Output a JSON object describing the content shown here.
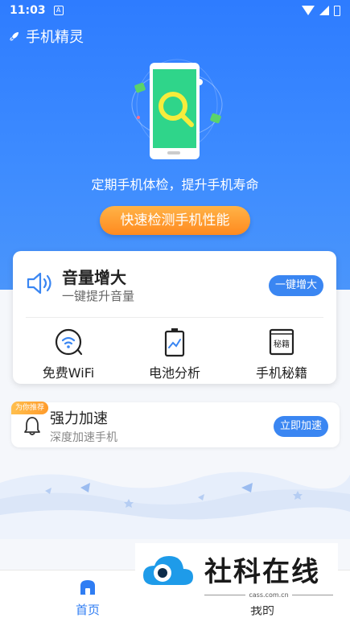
{
  "status_bar": {
    "time": "11:03",
    "notification_glyph": "A"
  },
  "app": {
    "title": "手机精灵",
    "icon": "rocket-icon"
  },
  "hero": {
    "slogan": "定期手机体检，提升手机寿命",
    "check_button": "快速检测手机性能"
  },
  "volume_card": {
    "title": "音量增大",
    "subtitle": "一键提升音量",
    "button": "一键增大"
  },
  "tools": [
    {
      "label": "免费WiFi",
      "icon": "wifi-icon"
    },
    {
      "label": "电池分析",
      "icon": "battery-icon"
    },
    {
      "label": "手机秘籍",
      "icon": "book-icon",
      "icon_text": "秘籍"
    }
  ],
  "recommend_card": {
    "badge": "为你推荐",
    "title": "强力加速",
    "subtitle": "深度加速手机",
    "button": "立即加速"
  },
  "bottom_nav": [
    {
      "label": "首页",
      "active": true
    },
    {
      "label": "我的",
      "active": false
    }
  ],
  "watermark": {
    "name": "社科在线",
    "domain": "cass.com.cn"
  },
  "colors": {
    "primary": "#2e7cff",
    "accent_orange": "#ff8a1f",
    "button_blue": "#3a86f2"
  }
}
